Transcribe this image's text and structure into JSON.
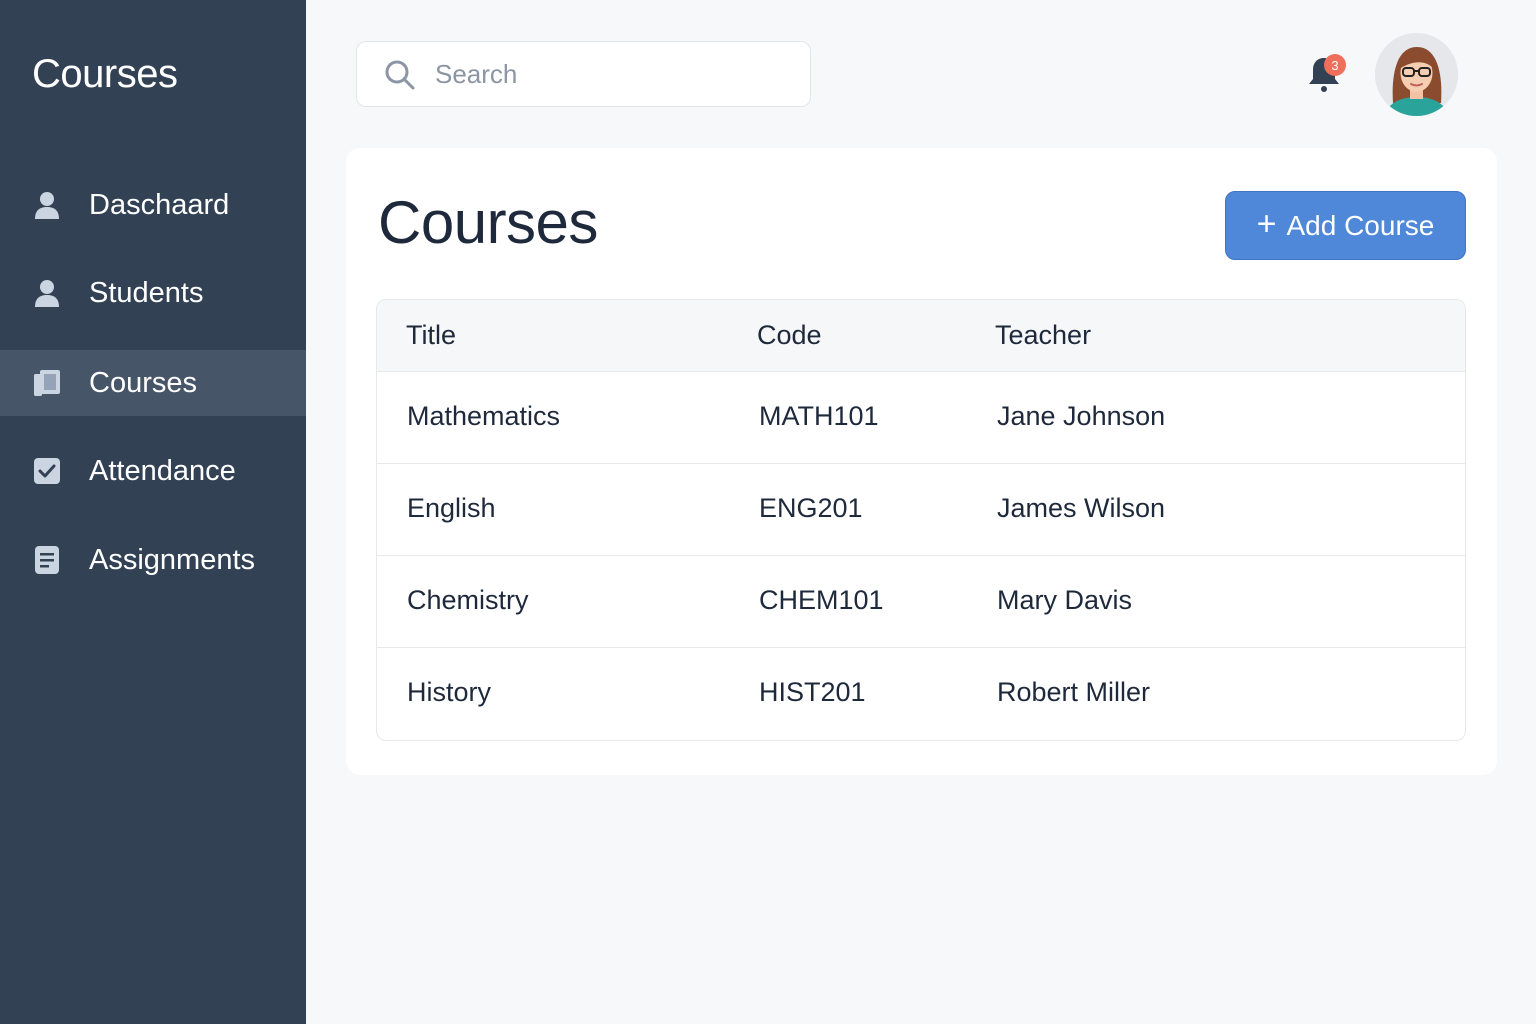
{
  "sidebar": {
    "title": "Courses",
    "items": [
      {
        "label": "Daschaard",
        "icon": "user-icon"
      },
      {
        "label": "Students",
        "icon": "user-icon"
      },
      {
        "label": "Courses",
        "icon": "book-icon",
        "active": true
      },
      {
        "label": "Attendance",
        "icon": "checkbox-icon"
      },
      {
        "label": "Assignments",
        "icon": "document-icon"
      }
    ]
  },
  "topbar": {
    "search_placeholder": "Search",
    "notification_count": "3"
  },
  "main": {
    "title": "Courses",
    "add_button_label": "Add Course",
    "table": {
      "columns": [
        "Title",
        "Code",
        "Teacher"
      ],
      "rows": [
        [
          "Mathematics",
          "MATH101",
          "Jane Johnson"
        ],
        [
          "English",
          "ENG201",
          "James Wilson"
        ],
        [
          "Chemistry",
          "CHEM101",
          "Mary Davis"
        ],
        [
          "History",
          "HIST201",
          "Robert Miller"
        ]
      ]
    }
  },
  "colors": {
    "sidebar_bg": "#334155",
    "sidebar_active": "#475569",
    "accent": "#4f87d9",
    "badge": "#ef6f5a"
  }
}
